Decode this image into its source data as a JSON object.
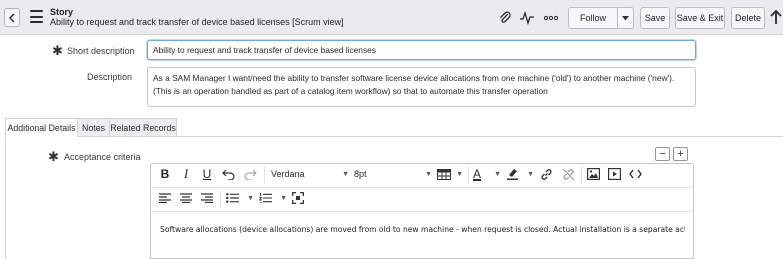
{
  "header": {
    "record_type": "Story",
    "record_title": "Ability to request and track transfer of device based licenses [Scrum view]",
    "follow_label": "Follow",
    "save_label": "Save",
    "save_exit_label": "Save & Exit",
    "delete_label": "Delete"
  },
  "form": {
    "short_description": {
      "label": "Short description",
      "value": "Ability to request and track transfer of device based licenses"
    },
    "description": {
      "label": "Description",
      "value": "As a SAM Manager I want/need the ability to transfer software license device allocations from one machine ('old') to another machine ('new'). (This is an operation handled as part of a catalog item workflow)  so that  to automate this transfer operation"
    }
  },
  "tabs": [
    {
      "label": "Additional Details",
      "active": true
    },
    {
      "label": "Notes",
      "active": false
    },
    {
      "label": "Related Records",
      "active": false
    }
  ],
  "acceptance": {
    "label": "Acceptance criteria",
    "font_family": "Verdana",
    "font_size": "8pt",
    "content": "Software allocations (device allocations) are moved from old to new machine - when request is closed. Actual installation is a separate activity."
  },
  "colors": {
    "header_bg": "#e9ebed",
    "focus_border": "#6ea8dc"
  }
}
